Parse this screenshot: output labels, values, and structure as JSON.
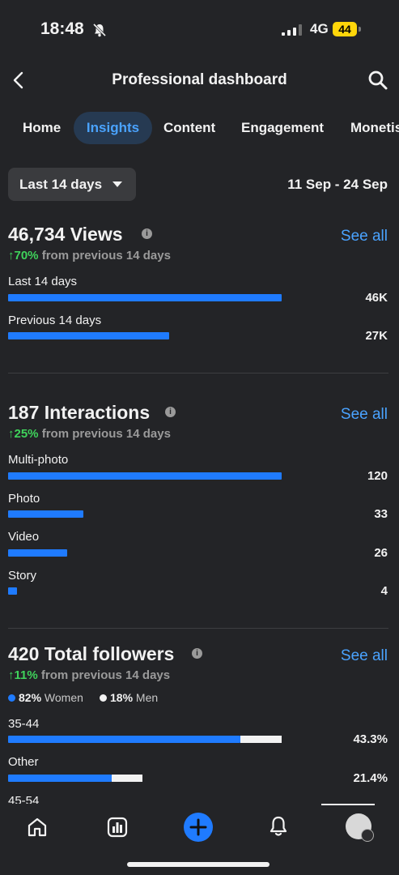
{
  "status_bar": {
    "time": "18:48",
    "network": "4G",
    "battery": "44"
  },
  "header": {
    "title": "Professional dashboard"
  },
  "tabs": [
    {
      "label": "Home"
    },
    {
      "label": "Insights"
    },
    {
      "label": "Content"
    },
    {
      "label": "Engagement"
    },
    {
      "label": "Monetis"
    }
  ],
  "period": {
    "label": "Last 14 days",
    "date_range": "11 Sep - 24 Sep"
  },
  "views": {
    "title": "46,734 Views",
    "see_all": "See all",
    "change_pct": "↑70%",
    "change_text": "from previous 14 days",
    "rows": [
      {
        "label": "Last 14 days",
        "value": "46K",
        "fraction": 1.0
      },
      {
        "label": "Previous 14 days",
        "value": "27K",
        "fraction": 0.59
      }
    ]
  },
  "interactions": {
    "title": "187 Interactions",
    "see_all": "See all",
    "change_pct": "↑25%",
    "change_text": "from previous 14 days",
    "rows": [
      {
        "label": "Multi-photo",
        "value": "120",
        "fraction": 1.0
      },
      {
        "label": "Photo",
        "value": "33",
        "fraction": 0.275
      },
      {
        "label": "Video",
        "value": "26",
        "fraction": 0.217
      },
      {
        "label": "Story",
        "value": "4",
        "fraction": 0.033
      }
    ]
  },
  "followers": {
    "title": "420 Total followers",
    "see_all": "See all",
    "change_pct": "↑11%",
    "change_text": "from previous 14 days",
    "legend": [
      {
        "pct": "82%",
        "label": "Women",
        "color": "#1f7bff"
      },
      {
        "pct": "18%",
        "label": "Men",
        "color": "#f2f2f2"
      }
    ],
    "rows": [
      {
        "label": "35-44",
        "value": "43.3%",
        "fraction": 1.0,
        "women_share": 0.85
      },
      {
        "label": "Other",
        "value": "21.4%",
        "fraction": 0.49,
        "women_share": 0.77
      },
      {
        "label": "45-54"
      }
    ]
  },
  "bottom_nav": [
    "home-icon",
    "insights-icon",
    "create-icon",
    "notifications-icon",
    "profile-avatar"
  ],
  "colors": {
    "accent": "#1f7bff",
    "link": "#4aa3ff",
    "positive": "#3fd35b",
    "background": "#232427"
  }
}
